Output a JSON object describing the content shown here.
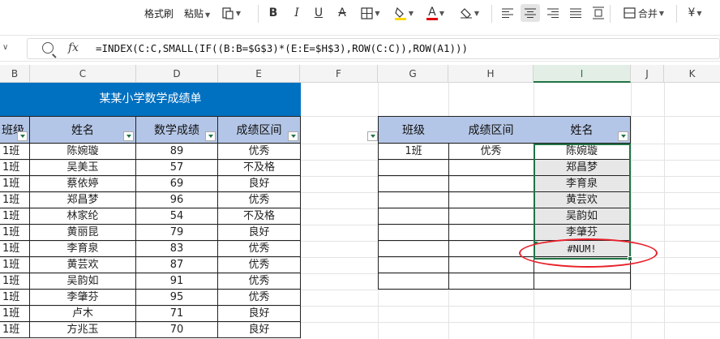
{
  "toolbar": {
    "format_painter": "格式刷",
    "paste": "粘贴",
    "bold": "B",
    "italic": "I",
    "underline": "U",
    "strikethrough": "A",
    "font_color": "A",
    "merge": "合并",
    "currency": "¥"
  },
  "formula_bar": {
    "fx": "fx",
    "formula": "=INDEX(C:C,SMALL(IF((B:B=$G$3)*(E:E=$H$3),ROW(C:C)),ROW(A1)))"
  },
  "columns": [
    "B",
    "C",
    "D",
    "E",
    "F",
    "G",
    "H",
    "I",
    "J",
    "K"
  ],
  "table_left": {
    "title": "某某小学数学成绩单",
    "headers": [
      "班级",
      "姓名",
      "数学成绩",
      "成绩区间"
    ],
    "rows": [
      [
        "1班",
        "陈婉璇",
        "89",
        "优秀"
      ],
      [
        "1班",
        "吴美玉",
        "57",
        "不及格"
      ],
      [
        "1班",
        "蔡依婷",
        "69",
        "良好"
      ],
      [
        "1班",
        "郑昌梦",
        "96",
        "优秀"
      ],
      [
        "1班",
        "林家纶",
        "54",
        "不及格"
      ],
      [
        "1班",
        "黄丽昆",
        "79",
        "良好"
      ],
      [
        "1班",
        "李育泉",
        "83",
        "优秀"
      ],
      [
        "1班",
        "黄芸欢",
        "87",
        "优秀"
      ],
      [
        "1班",
        "吴韵如",
        "91",
        "优秀"
      ],
      [
        "1班",
        "李肇芬",
        "95",
        "优秀"
      ],
      [
        "1班",
        "卢木",
        "71",
        "良好"
      ],
      [
        "1班",
        "方兆玉",
        "70",
        "良好"
      ]
    ]
  },
  "table_right": {
    "headers": [
      "班级",
      "成绩区间",
      "姓名"
    ],
    "criteria": [
      "1班",
      "优秀"
    ],
    "results": [
      "陈婉璇",
      "郑昌梦",
      "李育泉",
      "黄芸欢",
      "吴韵如",
      "李肇芬",
      "#NUM!",
      ""
    ]
  },
  "colors": {
    "title_bg": "#0070c0",
    "header_bg": "#b4c6e7",
    "selection": "#217346",
    "annotation": "#e8202a"
  }
}
